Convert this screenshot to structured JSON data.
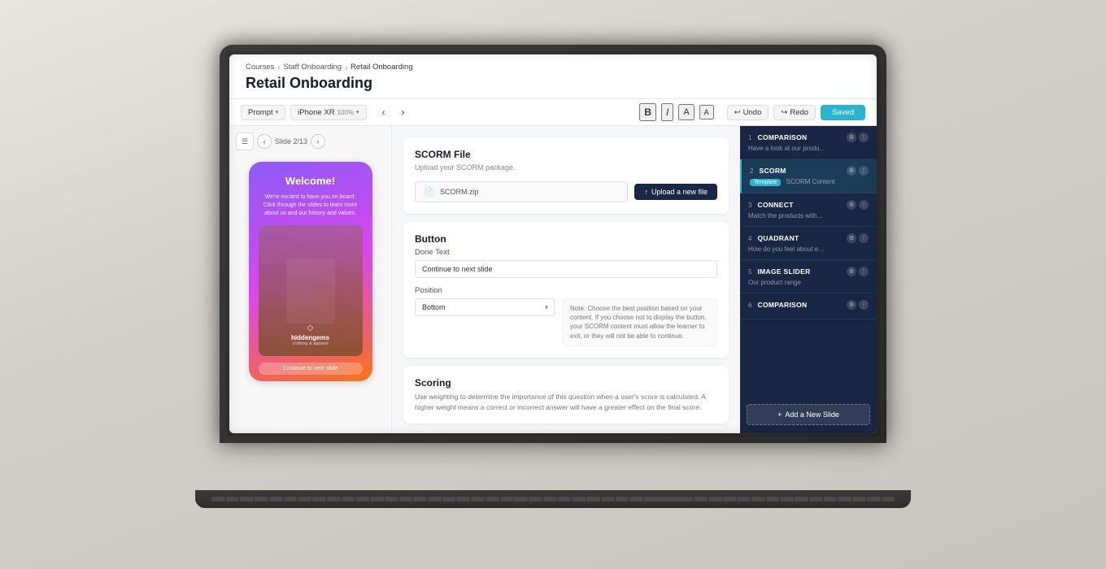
{
  "meta": {
    "title": "Retail Onboarding",
    "background_color": "#d8d5d0"
  },
  "breadcrumb": {
    "items": [
      "Courses",
      "Staff Onboarding",
      "Retail Onboarding"
    ]
  },
  "page_title": "Retail Onboarding",
  "toolbar": {
    "prompt_label": "Prompt",
    "device_label": "iPhone XR",
    "device_zoom": "100%",
    "undo_label": "Undo",
    "redo_label": "Redo",
    "saved_label": "Saved"
  },
  "slide_nav": {
    "current": "2/13",
    "label": "Slide 2/13"
  },
  "slide_preview": {
    "welcome_text": "Welcome!",
    "body_text": "We're excited to have you on board. Click through the slides to learn more about us and our history and values.",
    "logo_name": "hiddengems",
    "logo_tagline": "clothing & apparel",
    "cta_text": "Continue to next slide"
  },
  "scorm_card": {
    "title": "SCORM File",
    "subtitle": "Upload your SCORM package.",
    "file_name": "SCORM.zip",
    "upload_btn_label": "Upload a new file"
  },
  "button_card": {
    "title": "Button",
    "done_text_label": "Done Text",
    "done_text_value": "Continue to next slide",
    "position_label": "Position",
    "position_value": "Bottom",
    "note_text": "Note: Choose the best position based on your content. If you choose not to display the button, your SCORM content must allow the learner to exit, or they will not be able to continue."
  },
  "scoring_card": {
    "title": "Scoring",
    "description": "Use weighting to determine the importance of this question when a user's score is calculated. A higher weight means a correct or incorrect answer will have a greater effect on the final score."
  },
  "slides_list": {
    "items": [
      {
        "num": "1",
        "type": "COMPARISON",
        "desc": "Have a look at our produ...",
        "active": false,
        "badge": null
      },
      {
        "num": "2",
        "type": "SCORM",
        "desc": "SCORM Content",
        "active": true,
        "badge": "Template"
      },
      {
        "num": "3",
        "type": "CONNECT",
        "desc": "Match the products with...",
        "active": false,
        "badge": null
      },
      {
        "num": "4",
        "type": "QUADRANT",
        "desc": "How do you feel about e...",
        "active": false,
        "badge": null
      },
      {
        "num": "5",
        "type": "IMAGE SLIDER",
        "desc": "Our product range",
        "active": false,
        "badge": null
      },
      {
        "num": "6",
        "type": "COMPARISON",
        "desc": "",
        "active": false,
        "badge": null
      }
    ],
    "add_slide_label": "Add a New Slide"
  }
}
